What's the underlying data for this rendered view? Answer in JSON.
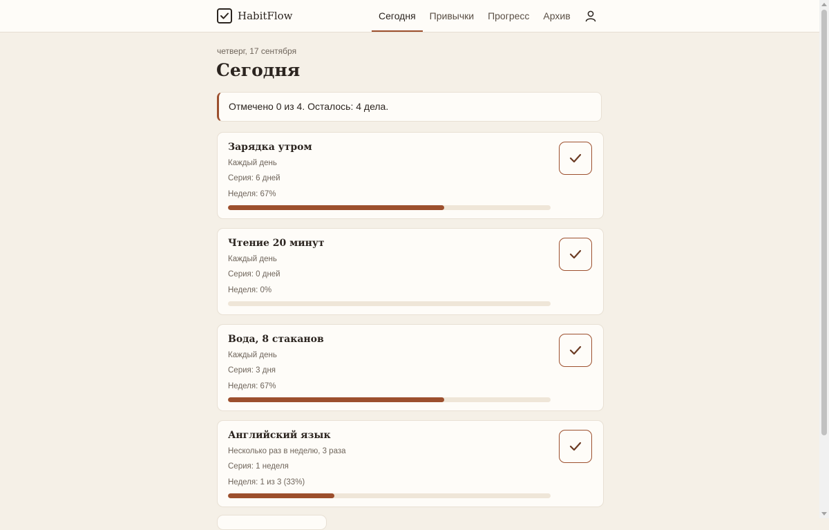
{
  "app": {
    "name": "HabitFlow"
  },
  "nav": {
    "tabs": [
      {
        "label": "Сегодня",
        "active": true
      },
      {
        "label": "Привычки",
        "active": false
      },
      {
        "label": "Прогресс",
        "active": false
      },
      {
        "label": "Архив",
        "active": false
      }
    ],
    "profile_icon": "user-icon"
  },
  "page": {
    "date": "четверг, 17 сентября",
    "title": "Сегодня",
    "summary": "Отмечено 0 из 4. Осталось: 4 дела."
  },
  "colors": {
    "accent": "#9c4f2d",
    "background": "#f5f0e7",
    "card": "#fefcf8",
    "track": "#efe6d8"
  },
  "habits": [
    {
      "name": "Зарядка утром",
      "frequency": "Каждый день",
      "streak": "Серия: 6 дней",
      "week": "Неделя: 67%",
      "progress": 0.67,
      "done": false
    },
    {
      "name": "Чтение 20 минут",
      "frequency": "Каждый день",
      "streak": "Серия: 0 дней",
      "week": "Неделя: 0%",
      "progress": 0,
      "done": false
    },
    {
      "name": "Вода, 8 стаканов",
      "frequency": "Каждый день",
      "streak": "Серия: 3 дня",
      "week": "Неделя: 67%",
      "progress": 0.67,
      "done": false
    },
    {
      "name": "Английский язык",
      "frequency": "Несколько раз в неделю, 3 раза",
      "streak": "Серия: 1 неделя",
      "week": "Неделя: 1 из 3 (33%)",
      "progress": 0.33,
      "done": false
    }
  ]
}
